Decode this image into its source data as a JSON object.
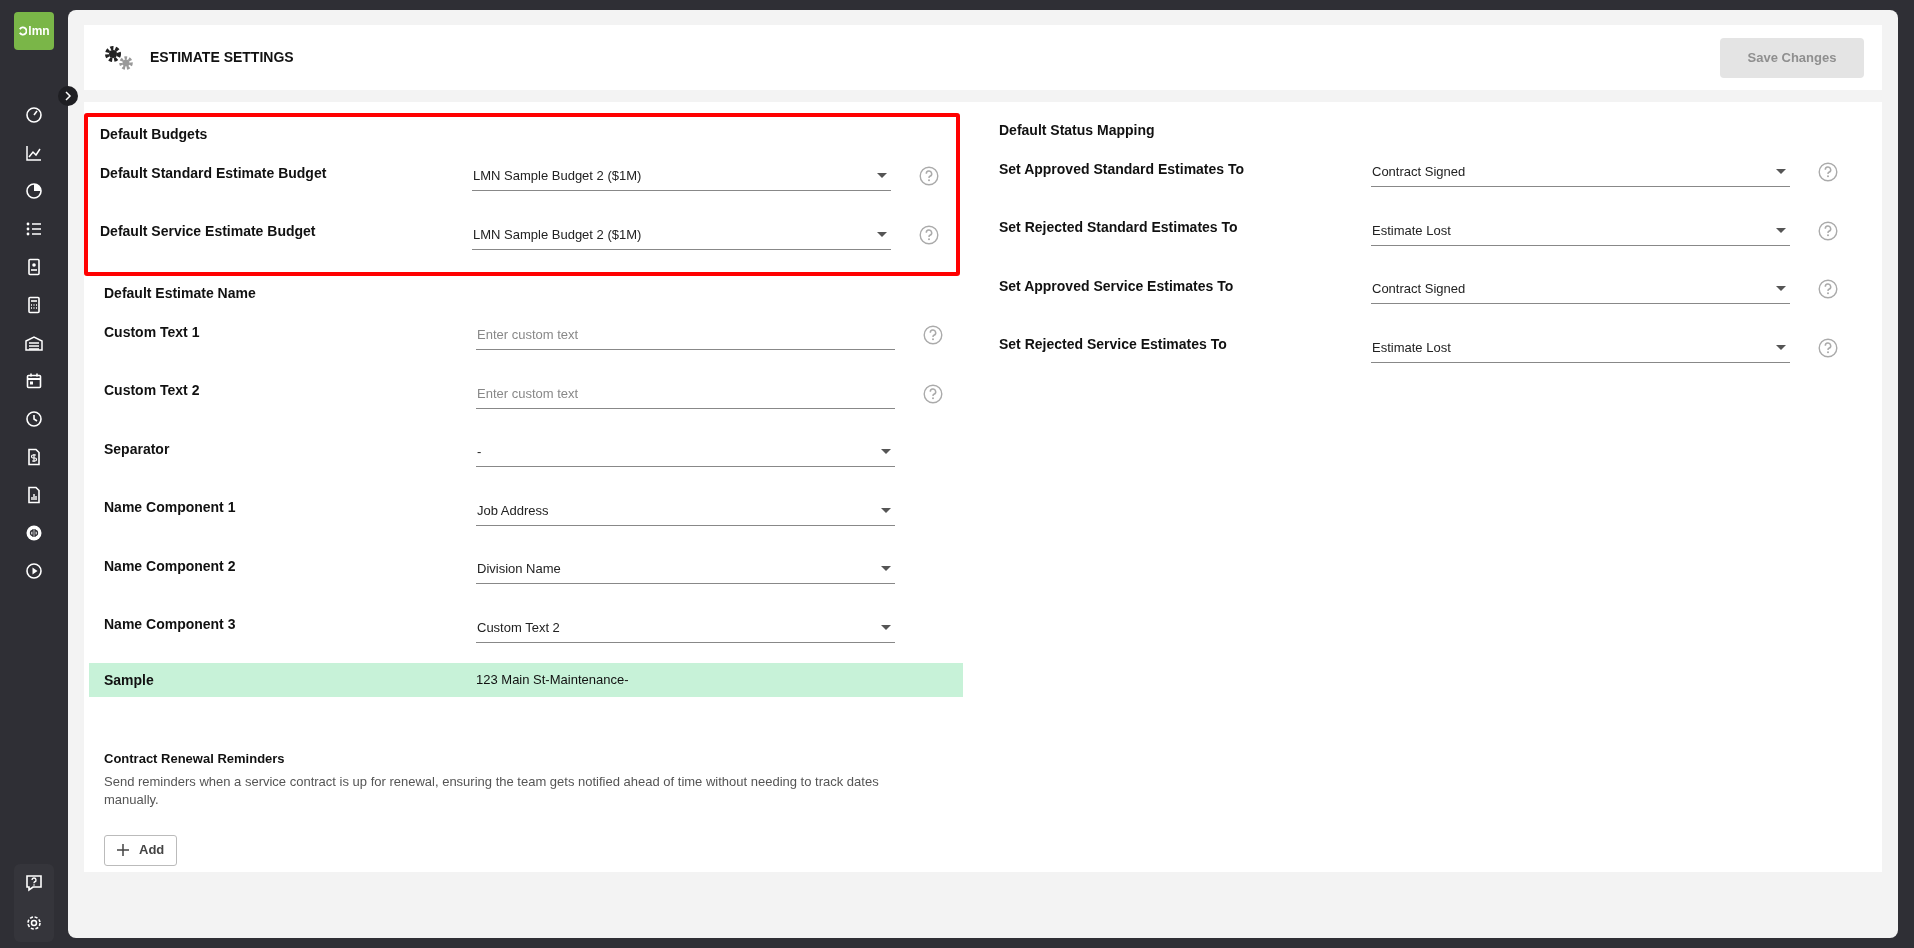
{
  "app": {
    "logo": "lmn"
  },
  "header": {
    "title": "ESTIMATE SETTINGS",
    "save_button": {
      "label": "Save Changes",
      "disabled": true
    }
  },
  "default_budgets": {
    "title": "Default Budgets",
    "highlighted": true,
    "fields": [
      {
        "label": "Default Standard Estimate Budget",
        "kind": "select",
        "value": "LMN Sample Budget 2 ($1M)",
        "help": true
      },
      {
        "label": "Default Service Estimate Budget",
        "kind": "select",
        "value": "LMN Sample Budget 2 ($1M)",
        "help": true
      }
    ]
  },
  "default_estimate_name": {
    "title": "Default Estimate Name",
    "fields": [
      {
        "label": "Custom Text 1",
        "kind": "text",
        "placeholder": "Enter custom text",
        "help": true
      },
      {
        "label": "Custom Text 2",
        "kind": "text",
        "placeholder": "Enter custom text",
        "help": true
      },
      {
        "label": "Separator",
        "kind": "select",
        "value": "-",
        "help": false
      },
      {
        "label": "Name Component 1",
        "kind": "select",
        "value": "Job Address",
        "help": false
      },
      {
        "label": "Name Component 2",
        "kind": "select",
        "value": "Division Name",
        "help": false
      },
      {
        "label": "Name Component 3",
        "kind": "select",
        "value": "Custom Text 2",
        "help": false
      }
    ]
  },
  "sample": {
    "label": "Sample",
    "value": "123 Main St-Maintenance-"
  },
  "contract_renewal": {
    "title": "Contract Renewal Reminders",
    "description": "Send reminders when a service contract is up for renewal, ensuring the team gets notified ahead of time without needing to track dates manually.",
    "add_button": "Add"
  },
  "default_status_mapping": {
    "title": "Default Status Mapping",
    "fields": [
      {
        "label": "Set Approved Standard Estimates To",
        "kind": "select",
        "value": "Contract Signed",
        "help": true
      },
      {
        "label": "Set Rejected Standard Estimates To",
        "kind": "select",
        "value": "Estimate Lost",
        "help": true
      },
      {
        "label": "Set Approved Service Estimates To",
        "kind": "select",
        "value": "Contract Signed",
        "help": true
      },
      {
        "label": "Set Rejected Service Estimates To",
        "kind": "select",
        "value": "Estimate Lost",
        "help": true
      }
    ]
  }
}
